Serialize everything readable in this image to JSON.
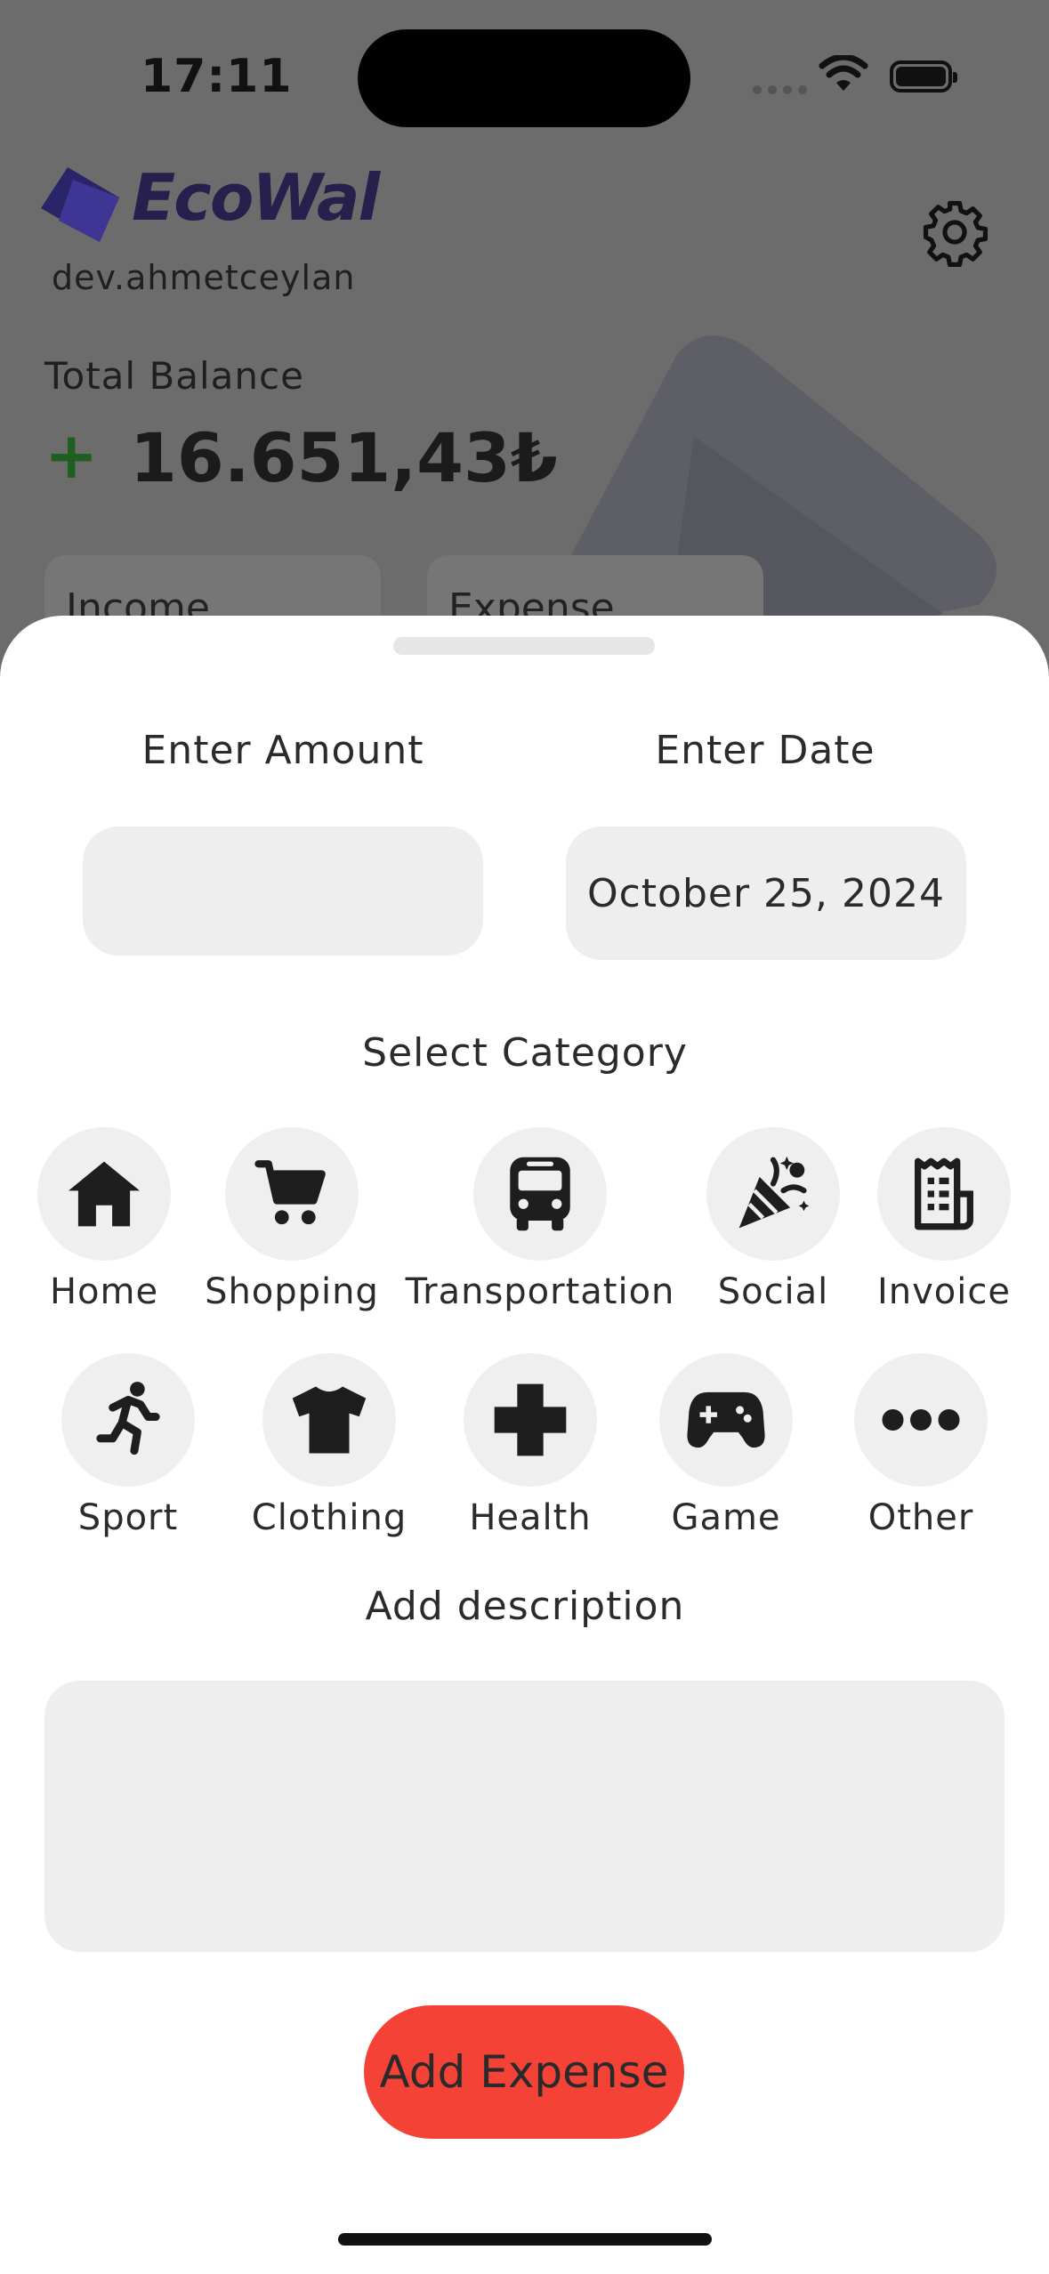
{
  "status_bar": {
    "time": "17:11"
  },
  "header": {
    "app_name": "EcoWal",
    "username": "dev.ahmetceylan"
  },
  "balance": {
    "label": "Total Balance",
    "sign": "+",
    "value": "16.651,43₺"
  },
  "cards": {
    "income_label": "Income",
    "expense_label": "Expense"
  },
  "sheet": {
    "amount_label": "Enter Amount",
    "amount_value": "",
    "date_label": "Enter Date",
    "date_value": "October 25, 2024",
    "category_label": "Select Category",
    "categories": [
      {
        "label": "Home",
        "icon": "home-icon"
      },
      {
        "label": "Shopping",
        "icon": "cart-icon"
      },
      {
        "label": "Transportation",
        "icon": "bus-icon"
      },
      {
        "label": "Social",
        "icon": "party-popper-icon"
      },
      {
        "label": "Invoice",
        "icon": "receipt-icon"
      },
      {
        "label": "Sport",
        "icon": "running-icon"
      },
      {
        "label": "Clothing",
        "icon": "tshirt-icon"
      },
      {
        "label": "Health",
        "icon": "plus-icon"
      },
      {
        "label": "Game",
        "icon": "gamepad-icon"
      },
      {
        "label": "Other",
        "icon": "more-icon"
      }
    ],
    "description_label": "Add description",
    "description_value": "",
    "submit_label": "Add Expense"
  },
  "colors": {
    "accent": "#f44336",
    "brand": "#25214c",
    "positive": "#1f5f22",
    "field_bg": "#eeeeee"
  }
}
